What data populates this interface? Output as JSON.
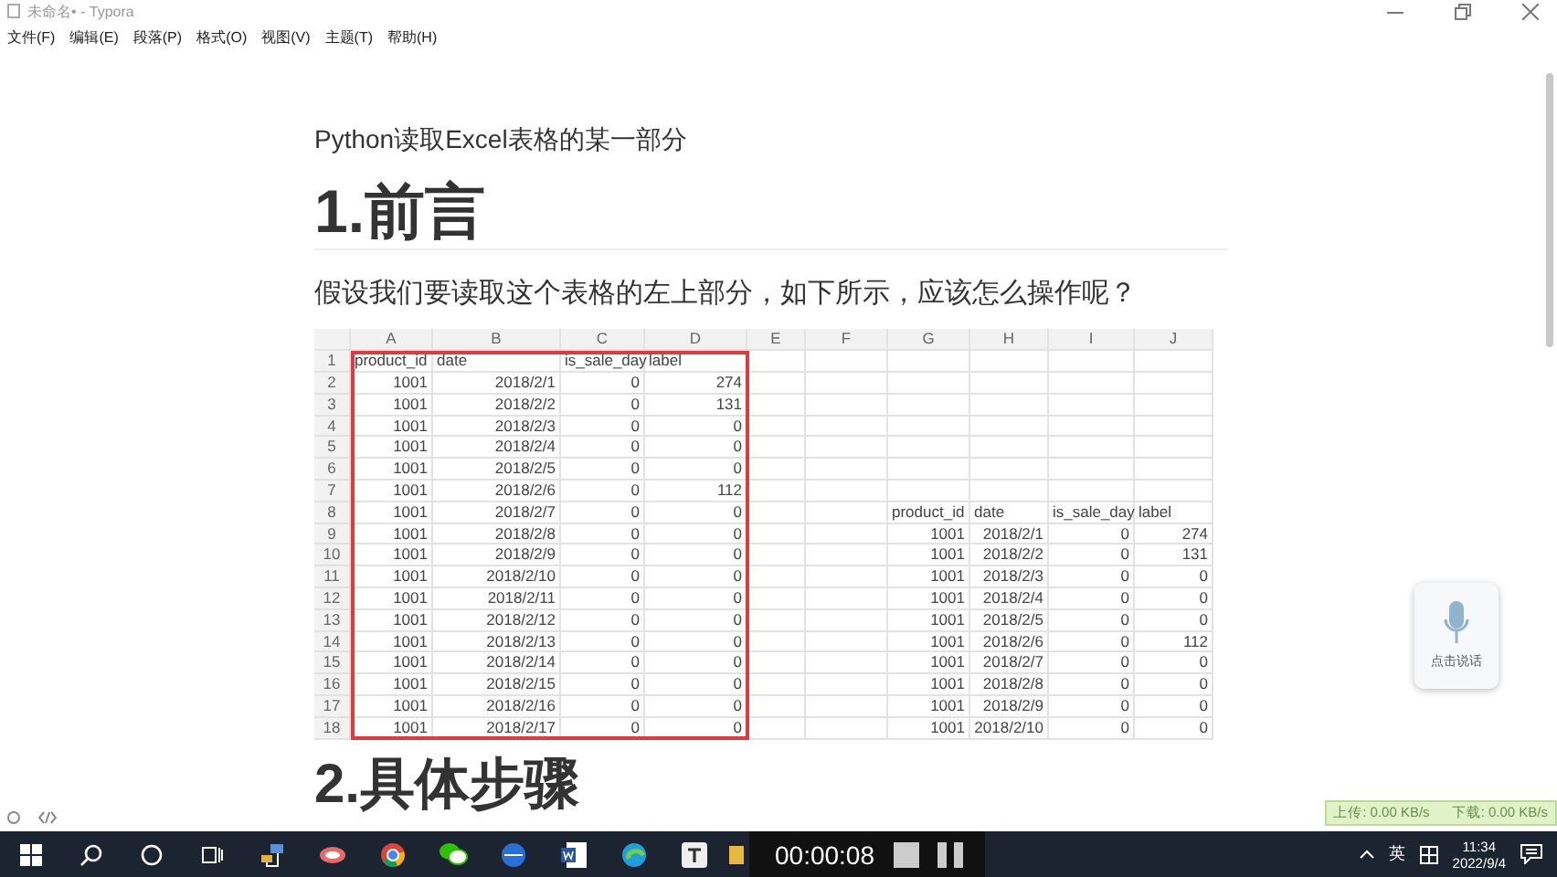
{
  "window": {
    "title": "未命名• - Typora"
  },
  "menu": [
    "文件(F)",
    "编辑(E)",
    "段落(P)",
    "格式(O)",
    "视图(V)",
    "主题(T)",
    "帮助(H)"
  ],
  "document": {
    "subtitle": "Python读取Excel表格的某一部分",
    "heading_1": "1.前言",
    "paragraph": "假设我们要读取这个表格的左上部分，如下所示，应该怎么操作呢？",
    "spreadsheet": {
      "columns": [
        "A",
        "B",
        "C",
        "D",
        "E",
        "F",
        "G",
        "H",
        "I",
        "J"
      ],
      "rows": [
        {
          "number": "1",
          "left": {
            "kind": "header",
            "cells": [
              "product_id",
              "date",
              "is_sale_day",
              "label"
            ]
          }
        },
        {
          "number": "2",
          "left": {
            "kind": "data",
            "cells": [
              "1001",
              "2018/2/1",
              "0",
              "274"
            ]
          }
        },
        {
          "number": "3",
          "left": {
            "kind": "data",
            "cells": [
              "1001",
              "2018/2/2",
              "0",
              "131"
            ]
          }
        },
        {
          "number": "4",
          "left": {
            "kind": "data",
            "cells": [
              "1001",
              "2018/2/3",
              "0",
              "0"
            ]
          }
        },
        {
          "number": "5",
          "left": {
            "kind": "data",
            "cells": [
              "1001",
              "2018/2/4",
              "0",
              "0"
            ]
          }
        },
        {
          "number": "6",
          "left": {
            "kind": "data",
            "cells": [
              "1001",
              "2018/2/5",
              "0",
              "0"
            ]
          }
        },
        {
          "number": "7",
          "left": {
            "kind": "data",
            "cells": [
              "1001",
              "2018/2/6",
              "0",
              "112"
            ]
          }
        },
        {
          "number": "8",
          "left": {
            "kind": "data",
            "cells": [
              "1001",
              "2018/2/7",
              "0",
              "0"
            ]
          },
          "right": {
            "kind": "header",
            "cells": [
              "product_id",
              "date",
              "is_sale_day",
              "label"
            ]
          }
        },
        {
          "number": "9",
          "left": {
            "kind": "data",
            "cells": [
              "1001",
              "2018/2/8",
              "0",
              "0"
            ]
          },
          "right": {
            "kind": "data",
            "cells": [
              "1001",
              "2018/2/1",
              "0",
              "274"
            ]
          }
        },
        {
          "number": "10",
          "left": {
            "kind": "data",
            "cells": [
              "1001",
              "2018/2/9",
              "0",
              "0"
            ]
          },
          "right": {
            "kind": "data",
            "cells": [
              "1001",
              "2018/2/2",
              "0",
              "131"
            ]
          }
        },
        {
          "number": "11",
          "left": {
            "kind": "data",
            "cells": [
              "1001",
              "2018/2/10",
              "0",
              "0"
            ]
          },
          "right": {
            "kind": "data",
            "cells": [
              "1001",
              "2018/2/3",
              "0",
              "0"
            ]
          }
        },
        {
          "number": "12",
          "left": {
            "kind": "data",
            "cells": [
              "1001",
              "2018/2/11",
              "0",
              "0"
            ]
          },
          "right": {
            "kind": "data",
            "cells": [
              "1001",
              "2018/2/4",
              "0",
              "0"
            ]
          }
        },
        {
          "number": "13",
          "left": {
            "kind": "data",
            "cells": [
              "1001",
              "2018/2/12",
              "0",
              "0"
            ]
          },
          "right": {
            "kind": "data",
            "cells": [
              "1001",
              "2018/2/5",
              "0",
              "0"
            ]
          }
        },
        {
          "number": "14",
          "left": {
            "kind": "data",
            "cells": [
              "1001",
              "2018/2/13",
              "0",
              "0"
            ]
          },
          "right": {
            "kind": "data",
            "cells": [
              "1001",
              "2018/2/6",
              "0",
              "112"
            ]
          }
        },
        {
          "number": "15",
          "left": {
            "kind": "data",
            "cells": [
              "1001",
              "2018/2/14",
              "0",
              "0"
            ]
          },
          "right": {
            "kind": "data",
            "cells": [
              "1001",
              "2018/2/7",
              "0",
              "0"
            ]
          }
        },
        {
          "number": "16",
          "left": {
            "kind": "data",
            "cells": [
              "1001",
              "2018/2/15",
              "0",
              "0"
            ]
          },
          "right": {
            "kind": "data",
            "cells": [
              "1001",
              "2018/2/8",
              "0",
              "0"
            ]
          }
        },
        {
          "number": "17",
          "left": {
            "kind": "data",
            "cells": [
              "1001",
              "2018/2/16",
              "0",
              "0"
            ]
          },
          "right": {
            "kind": "data",
            "cells": [
              "1001",
              "2018/2/9",
              "0",
              "0"
            ]
          }
        },
        {
          "number": "18",
          "left": {
            "kind": "data",
            "cells": [
              "1001",
              "2018/2/17",
              "0",
              "0"
            ]
          },
          "right": {
            "kind": "data",
            "cells": [
              "1001",
              "2018/2/10",
              "0",
              "0"
            ]
          }
        }
      ]
    },
    "heading_2": "2.具体步骤"
  },
  "voice_widget": {
    "label": "点击说话"
  },
  "network_monitor": {
    "upload": "上传: 0.00 KB/s",
    "download": "下载: 0.00 KB/s"
  },
  "recorder": {
    "time": "00:00:08"
  },
  "taskbar": {
    "ime": "英",
    "time": "11:34",
    "date": "2022/9/4"
  }
}
